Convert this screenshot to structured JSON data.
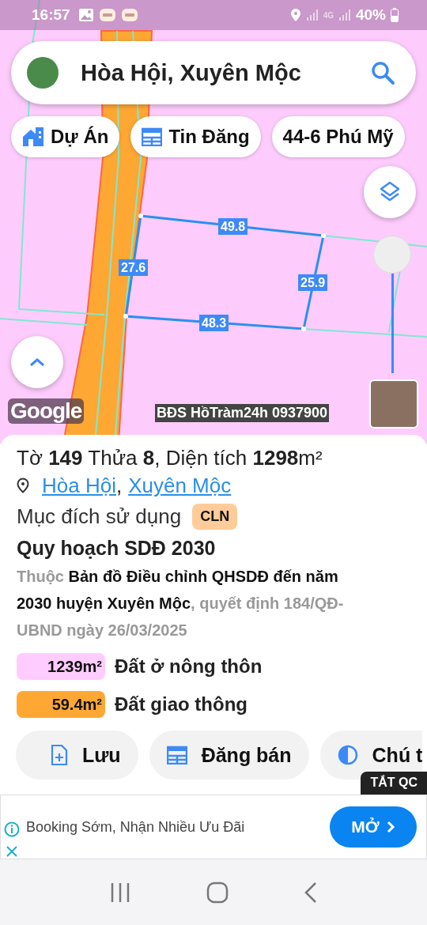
{
  "status_bar": {
    "time": "16:57",
    "network": "4G",
    "battery": "40%"
  },
  "search": {
    "value": "Hòa Hội, Xuyên Mộc"
  },
  "chips": [
    {
      "kind": "project",
      "label": "Dự Án"
    },
    {
      "kind": "listing",
      "label": "Tin Đăng"
    },
    {
      "kind": "plain",
      "label": "44-6 Phú Mỹ"
    }
  ],
  "map": {
    "edges": [
      {
        "label": "49.8"
      },
      {
        "label": "25.9"
      },
      {
        "label": "48.3"
      },
      {
        "label": "27.6"
      }
    ],
    "opacity_slider": {
      "level": 1
    },
    "logo": "Google",
    "overlay_text": "BĐS HồTràm24h 0937900"
  },
  "parcel": {
    "title": "Tờ **149** Thửa **8**, Diện tích **1298**m²",
    "location": {
      "parts": [
        "Hòa Hội",
        "Xuyên Mộc"
      ],
      "separator": ","
    },
    "purpose": {
      "label": "Mục đích sử dụng",
      "code": "CLN"
    },
    "planning_title": "Quy hoạch SDĐ 2030",
    "planning_note": "Thuộc **Bản đồ Điều chỉnh QHSDĐ đến năm 2030 huyện Xuyên Mộc**, quyết định 184/QĐ-UBND ngày 26/03/2025",
    "land_uses": [
      {
        "area": "1239m²",
        "label": "Đất ở nông thôn",
        "color": "#ffccff"
      },
      {
        "area": "59.4m²",
        "label": "Đất giao thông",
        "color": "#ffa733"
      }
    ],
    "actions": [
      {
        "kind": "save",
        "label": "Lưu"
      },
      {
        "kind": "post",
        "label": "Đăng bán"
      },
      {
        "kind": "legend",
        "label": "Chú t"
      }
    ]
  },
  "ad_toggle": "TẮT QC",
  "ad": {
    "text": "Booking Sớm, Nhận Nhiều Ưu Đãi",
    "button": "MỞ"
  }
}
